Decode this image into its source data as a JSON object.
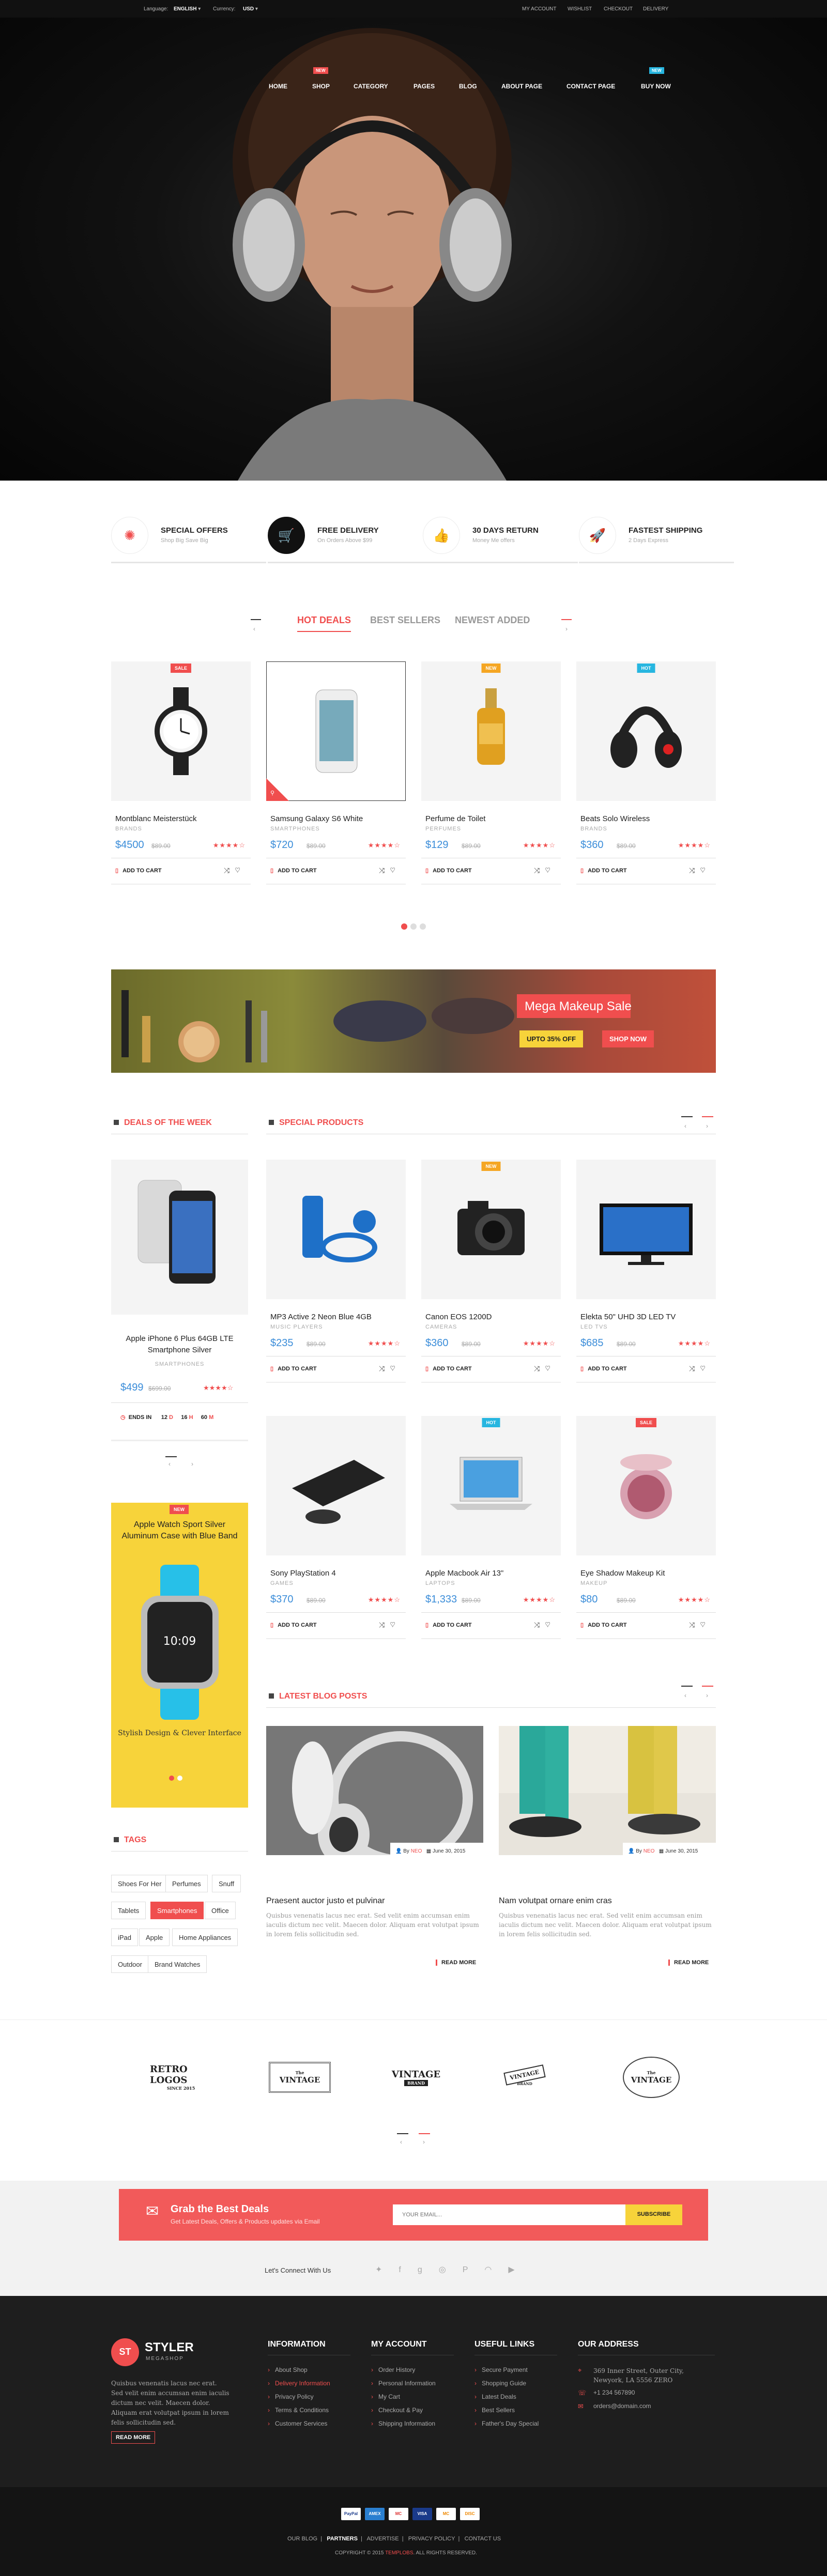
{
  "topbar": {
    "language_label": "Language:",
    "language": "ENGLISH",
    "currency_label": "Currency:",
    "currency": "USD",
    "my_account": "MY ACCOUNT",
    "wishlist": "WISHLIST",
    "checkout": "CHECKOUT",
    "delivery": "DELIVERY"
  },
  "nav": {
    "items": [
      "HOME",
      "SHOP",
      "CATEGORY",
      "PAGES",
      "BLOG",
      "ABOUT PAGE",
      "CONTACT PAGE",
      "BUY NOW"
    ],
    "badge_shop": "NEW",
    "badge_buy": "NEW"
  },
  "features": [
    {
      "title": "SPECIAL OFFERS",
      "subtitle": "Shop Big Save Big"
    },
    {
      "title": "FREE DELIVERY",
      "subtitle": "On Orders Above $99"
    },
    {
      "title": "30 DAYS RETURN",
      "subtitle": "Money Me offers"
    },
    {
      "title": "FASTEST SHIPPING",
      "subtitle": "2 Days Express"
    }
  ],
  "tabs": [
    "HOT DEALS",
    "BEST SELLERS",
    "NEWEST ADDED"
  ],
  "add_to_cart": "ADD TO CART",
  "hot_products": [
    {
      "name": "Montblanc Meisterstück",
      "brand": "BRANDS",
      "price": "$4500",
      "old": "$89.00",
      "badge": "SALE",
      "stars": "★★★★☆"
    },
    {
      "name": "Samsung Galaxy S6 White",
      "brand": "SMARTPHONES",
      "price": "$720",
      "old": "$89.00",
      "badge": "",
      "stars": "★★★★☆"
    },
    {
      "name": "Perfume de Toilet",
      "brand": "PERFUMES",
      "price": "$129",
      "old": "$89.00",
      "badge": "NEW",
      "stars": "★★★★☆"
    },
    {
      "name": "Beats Solo Wireless",
      "brand": "BRANDS",
      "price": "$360",
      "old": "$89.00",
      "badge": "HOT",
      "stars": "★★★★☆"
    }
  ],
  "banner": {
    "title": "Mega Makeup Sale",
    "offer": "UPTO 35% OFF",
    "cta": "SHOP NOW"
  },
  "deals": {
    "heading": "DEALS OF THE WEEK",
    "name": "Apple iPhone 6 Plus 64GB LTE Smartphone Silver",
    "brand": "SMARTPHONES",
    "price": "$499",
    "old": "$699.00",
    "stars": "★★★★☆",
    "ends": "ENDS IN",
    "d": "12",
    "dl": "D",
    "h": "16",
    "hl": "H",
    "m": "60",
    "ml": "M"
  },
  "special": {
    "heading": "SPECIAL PRODUCTS",
    "items": [
      {
        "name": "MP3 Active 2 Neon Blue 4GB",
        "brand": "MUSIC PLAYERS",
        "price": "$235",
        "old": "$89.00",
        "badge": "",
        "stars": "★★★★☆"
      },
      {
        "name": "Canon EOS 1200D",
        "brand": "CAMERAS",
        "price": "$360",
        "old": "$89.00",
        "badge": "NEW",
        "stars": "★★★★☆"
      },
      {
        "name": "Elekta 50\" UHD 3D LED TV",
        "brand": "LED TVS",
        "price": "$685",
        "old": "$89.00",
        "badge": "",
        "stars": "★★★★☆"
      },
      {
        "name": "Sony PlayStation 4",
        "brand": "GAMES",
        "price": "$370",
        "old": "$89.00",
        "badge": "",
        "stars": "★★★★☆"
      },
      {
        "name": "Apple Macbook Air 13\"",
        "brand": "LAPTOPS",
        "price": "$1,333",
        "old": "$89.00",
        "badge": "HOT",
        "stars": "★★★★☆"
      },
      {
        "name": "Eye Shadow Makeup Kit",
        "brand": "MAKEUP",
        "price": "$80",
        "old": "$89.00",
        "badge": "SALE",
        "stars": "★★★★☆"
      }
    ]
  },
  "promo": {
    "badge": "NEW",
    "title": "Apple Watch Sport Silver Aluminum Case with Blue Band",
    "time": "10:09",
    "caption": "Stylish Design & Clever Interface"
  },
  "blog": {
    "heading": "LATEST BLOG POSTS",
    "posts": [
      {
        "title": "Praesent auctor justo et pulvinar",
        "by": "By",
        "author": "NEO",
        "date": "June 30, 2015",
        "text": "Quisbus venenatis lacus nec erat. Sed velit enim accumsan enim iaculis dictum nec velit. Maecen dolor. Aliquam erat volutpat ipsum in lorem felis sollicitudin sed.",
        "more": "READ MORE"
      },
      {
        "title": "Nam volutpat ornare enim cras",
        "by": "By",
        "author": "NEO",
        "date": "June 30, 2015",
        "text": "Quisbus venenatis lacus nec erat. Sed velit enim accumsan enim iaculis dictum nec velit. Maecen dolor. Aliquam erat volutpat ipsum in lorem felis sollicitudin sed.",
        "more": "READ MORE"
      }
    ]
  },
  "tags": {
    "heading": "TAGS",
    "items": [
      "Shoes For Her",
      "Perfumes",
      "Snuff",
      "Tablets",
      "Smartphones",
      "Office",
      "iPad",
      "Apple",
      "Home Appliances",
      "Outdoor",
      "Brand Watches"
    ]
  },
  "logos": [
    {
      "top": "RETRO LOGOS",
      "bottom": "SINCE 2015"
    },
    {
      "top": "VINTAGE",
      "bottom": "The"
    },
    {
      "top": "VINTAGE",
      "bottom": "BRAND"
    },
    {
      "top": "VINTAGE",
      "bottom": "BRAND"
    },
    {
      "top": "VINTAGE",
      "bottom": "The"
    }
  ],
  "newsletter": {
    "title": "Grab the Best Deals",
    "subtitle": "Get Latest Deals, Offers & Products updates via Email",
    "placeholder": "YOUR EMAIL...",
    "button": "SUBSCRIBE"
  },
  "connect": "Let's Connect With Us",
  "footer": {
    "brand": "STYLER",
    "sub": "MEGASHOP",
    "logo": "ST",
    "about": "Quisbus venenatis lacus nec erat. Sed velit enim accumsan enim iaculis dictum nec velit. Maecen dolor. Aliquam erat volutpat ipsum in lorem felis sollicitudin sed.",
    "read_more": "READ MORE",
    "information": {
      "title": "INFORMATION",
      "items": [
        "About Shop",
        "Delivery Information",
        "Privacy Policy",
        "Terms & Conditions",
        "Customer Services"
      ]
    },
    "account": {
      "title": "MY ACCOUNT",
      "items": [
        "Order History",
        "Personal Information",
        "My Cart",
        "Checkout & Pay",
        "Shipping Information"
      ]
    },
    "useful": {
      "title": "USEFUL LINKS",
      "items": [
        "Secure Payment",
        "Shopping Guide",
        "Latest Deals",
        "Best Sellers",
        "Father's Day Special"
      ]
    },
    "address": {
      "title": "OUR ADDRESS",
      "street": "369 Inner Street, Outer City, Newyork, LA 5556 ZERO",
      "phone": "+1 234 567890",
      "email": "orders@domain.com"
    }
  },
  "bottom": {
    "links": [
      "OUR BLOG",
      "PARTNERS",
      "ADVERTISE",
      "PRIVACY POLICY",
      "CONTACT US"
    ],
    "copyright": "COPYRIGHT © 2015",
    "company": "TEMPLOBS",
    "rights": ". ALL RIGHTS RESERVED.",
    "payments": [
      "PayPal",
      "AMEX",
      "MC",
      "VISA",
      "MC",
      "DISC"
    ]
  },
  "colors": {
    "accent": "#f04e4e",
    "price": "#3b8dd9",
    "promo": "#f7d33a",
    "badge_new": "#f5a623",
    "badge_hot": "#27b6e0"
  }
}
